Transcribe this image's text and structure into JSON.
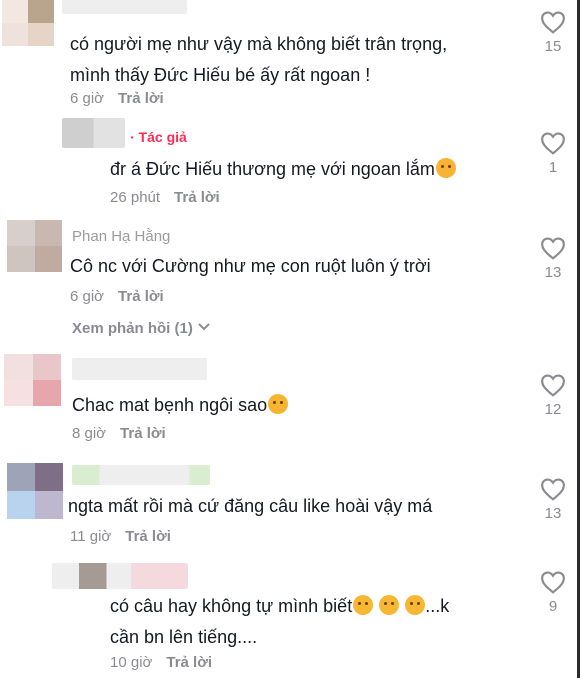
{
  "comments": [
    {
      "text_lines": [
        "có người mẹ như vậy mà không biết trân trọng,",
        "mình thấy Đức Hiếu bé ấy rất ngoan !"
      ],
      "time": "6 giờ",
      "reply_label": "Trả lời",
      "likes": "15"
    },
    {
      "author_tag": "· Tác giả",
      "text_lines": [
        "đr á Đức Hiếu thương mẹ với ngoan lắm"
      ],
      "time": "26 phút",
      "reply_label": "Trả lời",
      "likes": "1"
    },
    {
      "name": "Phan Hạ Hằng",
      "text_lines": [
        "Cô nc với Cường như mẹ con ruột luôn ý trời"
      ],
      "time": "6 giờ",
      "reply_label": "Trả lời",
      "likes": "13",
      "view_replies": "Xem phản hồi (1)"
    },
    {
      "text_lines": [
        "Chac mat bẹnh ngôi sao"
      ],
      "time": "8 giờ",
      "reply_label": "Trả lời",
      "likes": "12"
    },
    {
      "text_lines": [
        "ngta mất rồi mà cứ đăng câu like hoài vậy má"
      ],
      "time": "11 giờ",
      "reply_label": "Trả lời",
      "likes": "13"
    },
    {
      "text_lines": [
        "có câu hay không tự mình biết",
        "cần bn lên tiếng...."
      ],
      "text_suffix": "...k",
      "time": "10 giờ",
      "reply_label": "Trả lời",
      "likes": "9"
    }
  ],
  "colors": {
    "author_tag": "#fe2c55",
    "meta": "#8a8b91",
    "text": "#161823"
  },
  "icons": {
    "like": "heart-outline-icon",
    "chevron": "chevron-down-icon"
  }
}
